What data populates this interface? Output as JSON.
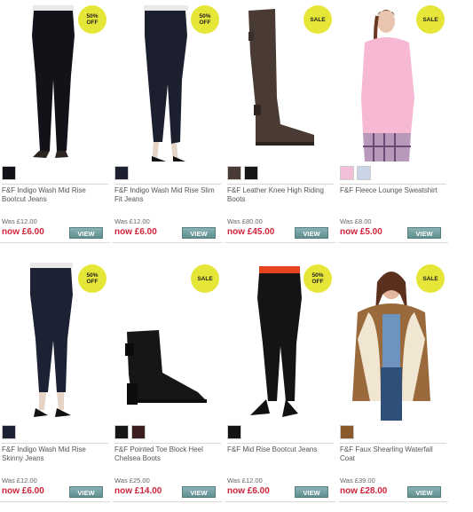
{
  "products": [
    {
      "title": "F&F Indigo Wash Mid Rise Bootcut Jeans",
      "was": "Was £12.00",
      "now": "now £6.00",
      "badge": "50%\nOFF",
      "swatches": [
        "#121218"
      ],
      "view": "VIEW",
      "image": "dark-bootcut-jeans"
    },
    {
      "title": "F&F Indigo Wash Mid Rise Slim Fit Jeans",
      "was": "Was £12.00",
      "now": "now £6.00",
      "badge": "50%\nOFF",
      "swatches": [
        "#1b1f2e"
      ],
      "view": "VIEW",
      "image": "dark-slim-jeans"
    },
    {
      "title": "F&F Leather Knee High Riding Boots",
      "was": "Was £80.00",
      "now": "now £45.00",
      "badge": "SALE",
      "swatches": [
        "#4a3a34",
        "#161616"
      ],
      "view": "VIEW",
      "image": "brown-riding-boot"
    },
    {
      "title": "F&F Fleece Lounge Sweatshirt",
      "was": "Was £8.00",
      "now": "now £5.00",
      "badge": "SALE",
      "swatches": [
        "#f3bfd8",
        "#c9d4e6"
      ],
      "view": "VIEW",
      "image": "pink-sweatshirt"
    },
    {
      "title": "F&F Indigo Wash Mid Rise Skinny Jeans",
      "was": "Was £12.00",
      "now": "now £6.00",
      "badge": "50%\nOFF",
      "swatches": [
        "#1c2233"
      ],
      "view": "VIEW",
      "image": "dark-skinny-jeans"
    },
    {
      "title": "F&F Pointed Toe Block Heel Chelsea Boots",
      "was": "Was £25.00",
      "now": "now £14.00",
      "badge": "SALE",
      "swatches": [
        "#161616",
        "#3a1d1f"
      ],
      "view": "VIEW",
      "image": "black-chelsea-boot"
    },
    {
      "title": "F&F Mid Rise Bootcut Jeans",
      "was": "Was £12.00",
      "now": "now £6.00",
      "badge": "50%\nOFF",
      "swatches": [
        "#141414"
      ],
      "view": "VIEW",
      "image": "black-bootcut-jeans"
    },
    {
      "title": "F&F Faux Shearling Waterfall Coat",
      "was": "Was £39.00",
      "now": "now £28.00",
      "badge": "SALE",
      "swatches": [
        "#8a5a2b"
      ],
      "view": "VIEW",
      "image": "shearling-coat"
    }
  ],
  "colors": {
    "badge": "#e5e637",
    "price": "#d0233a",
    "view_button": "#6f9c9d"
  }
}
